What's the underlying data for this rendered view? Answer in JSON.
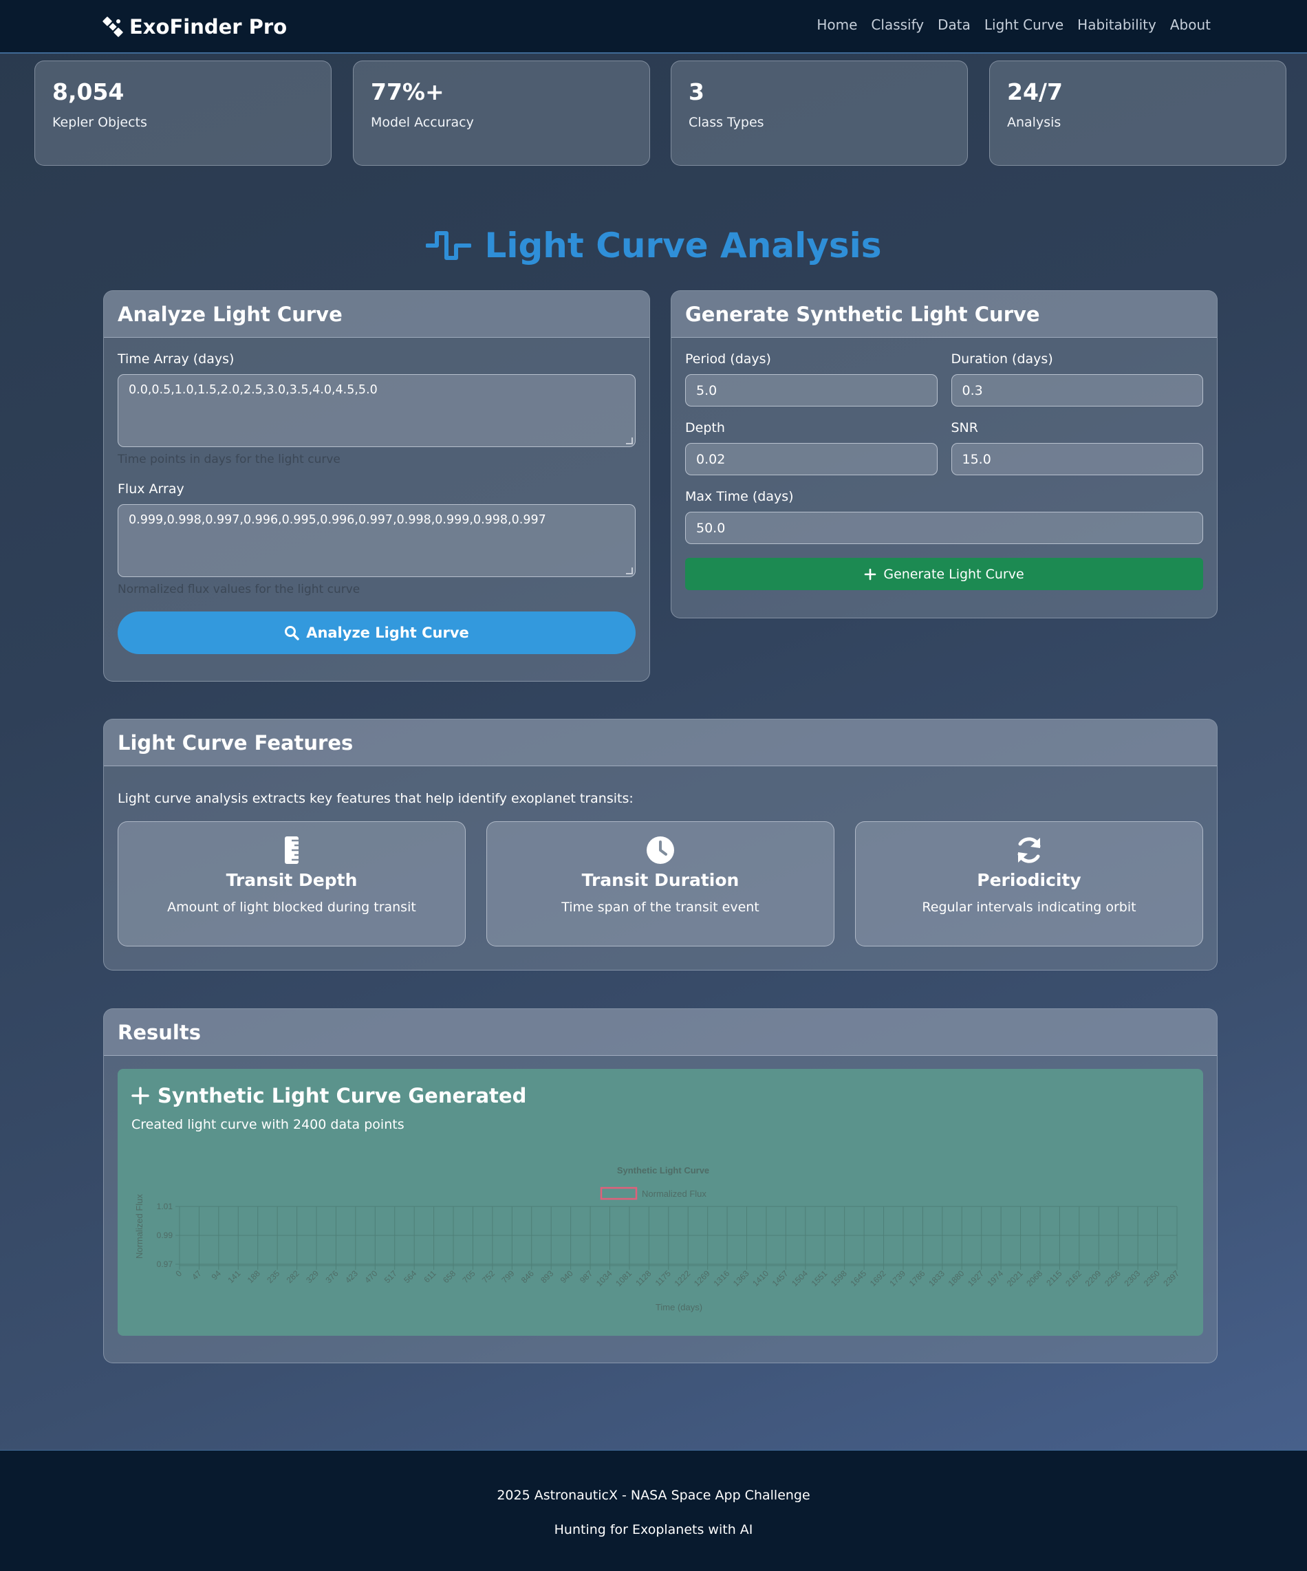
{
  "nav": {
    "brand": "ExoFinder Pro",
    "links": [
      "Home",
      "Classify",
      "Data",
      "Light Curve",
      "Habitability",
      "About"
    ]
  },
  "stats": [
    {
      "value": "8,054",
      "label": "Kepler Objects"
    },
    {
      "value": "77%+",
      "label": "Model Accuracy"
    },
    {
      "value": "3",
      "label": "Class Types"
    },
    {
      "value": "24/7",
      "label": "Analysis"
    }
  ],
  "page_title": "Light Curve Analysis",
  "analyze": {
    "title": "Analyze Light Curve",
    "time_label": "Time Array (days)",
    "time_value": "0.0,0.5,1.0,1.5,2.0,2.5,3.0,3.5,4.0,4.5,5.0",
    "time_hint": "Time points in days for the light curve",
    "flux_label": "Flux Array",
    "flux_value": "0.999,0.998,0.997,0.996,0.995,0.996,0.997,0.998,0.999,0.998,0.997",
    "flux_hint": "Normalized flux values for the light curve",
    "button": "Analyze Light Curve"
  },
  "generate": {
    "title": "Generate Synthetic Light Curve",
    "period_label": "Period (days)",
    "period_value": "5.0",
    "duration_label": "Duration (days)",
    "duration_value": "0.3",
    "depth_label": "Depth",
    "depth_value": "0.02",
    "snr_label": "SNR",
    "snr_value": "15.0",
    "maxtime_label": "Max Time (days)",
    "maxtime_value": "50.0",
    "button": "Generate Light Curve"
  },
  "features": {
    "title": "Light Curve Features",
    "intro": "Light curve analysis extracts key features that help identify exoplanet transits:",
    "items": [
      {
        "title": "Transit Depth",
        "desc": "Amount of light blocked during transit",
        "icon": "ruler-icon"
      },
      {
        "title": "Transit Duration",
        "desc": "Time span of the transit event",
        "icon": "clock-icon"
      },
      {
        "title": "Periodicity",
        "desc": "Regular intervals indicating orbit",
        "icon": "sync-icon"
      }
    ]
  },
  "results": {
    "title": "Results",
    "box_title": "Synthetic Light Curve Generated",
    "box_sub": "Created light curve with 2400 data points"
  },
  "chart_data": {
    "type": "line",
    "title": "Synthetic Light Curve",
    "legend": "Normalized Flux",
    "legend_position": "top",
    "xlabel": "Time (days)",
    "ylabel": "Normalized Flux",
    "yticks": [
      "1.01",
      "0.99",
      "0.97"
    ],
    "xticks": [
      "0",
      "47",
      "94",
      "141",
      "188",
      "235",
      "282",
      "329",
      "376",
      "423",
      "470",
      "517",
      "564",
      "611",
      "658",
      "705",
      "752",
      "799",
      "846",
      "893",
      "940",
      "987",
      "1034",
      "1081",
      "1128",
      "1175",
      "1222",
      "1269",
      "1316",
      "1363",
      "1410",
      "1457",
      "1504",
      "1551",
      "1598",
      "1645",
      "1692",
      "1739",
      "1786",
      "1833",
      "1880",
      "1927",
      "1974",
      "2021",
      "2068",
      "2115",
      "2162",
      "2209",
      "2256",
      "2303",
      "2350",
      "2397"
    ],
    "grid": true,
    "series": [
      {
        "name": "Normalized Flux",
        "color": "#e0607a",
        "values": []
      }
    ]
  },
  "footer": {
    "line1": "2025 AstronauticX - NASA Space App Challenge",
    "line2": "Hunting for Exoplanets with AI"
  }
}
